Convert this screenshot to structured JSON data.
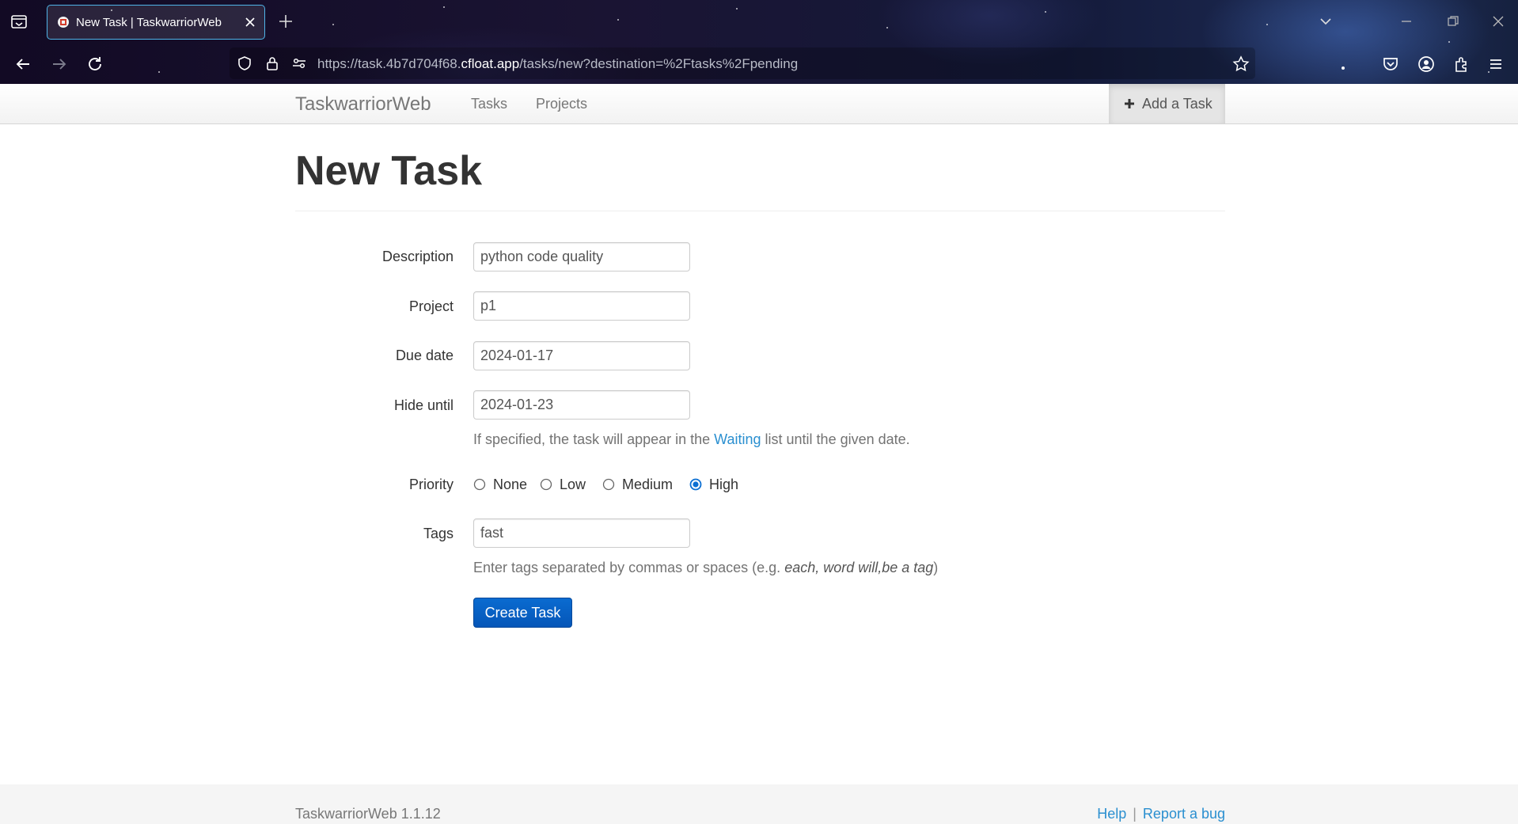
{
  "browser": {
    "tab_title": "New Task | TaskwarriorWeb",
    "url_prefix": "https://task.4b7d704f68.",
    "url_host": "cfloat.app",
    "url_path": "/tasks/new?destination=%2Ftasks%2Fpending"
  },
  "navbar": {
    "brand": "TaskwarriorWeb",
    "links": [
      "Tasks",
      "Projects"
    ],
    "add_task": "Add a Task"
  },
  "page": {
    "title": "New Task"
  },
  "form": {
    "description": {
      "label": "Description",
      "value": "python code quality"
    },
    "project": {
      "label": "Project",
      "value": "p1"
    },
    "due": {
      "label": "Due date",
      "value": "2024-01-17"
    },
    "hide_until": {
      "label": "Hide until",
      "value": "2024-01-23",
      "help_before": "If specified, the task will appear in the ",
      "help_link": "Waiting",
      "help_after": " list until the given date."
    },
    "priority": {
      "label": "Priority",
      "options": [
        "None",
        "Low",
        "Medium",
        "High"
      ],
      "selected": "High"
    },
    "tags": {
      "label": "Tags",
      "value": "fast",
      "help_before": "Enter tags separated by commas or spaces (e.g. ",
      "help_example": "each, word will,be a tag",
      "help_after": ")"
    },
    "submit": "Create Task"
  },
  "footer": {
    "version": "TaskwarriorWeb 1.1.12",
    "help": "Help",
    "sep": "|",
    "report": "Report a bug"
  },
  "colors": {
    "link": "#2a8fd0",
    "primary_button": "#0a6bd0",
    "tab_border": "#4fb4e8"
  }
}
